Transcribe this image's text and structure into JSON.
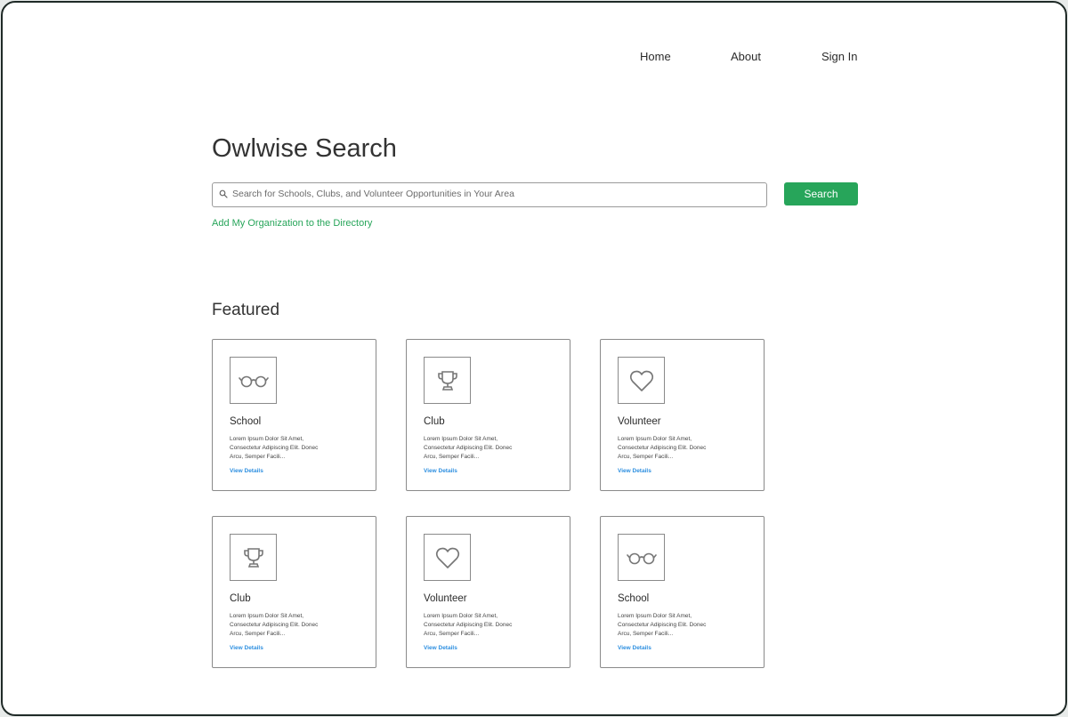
{
  "nav": {
    "home": "Home",
    "about": "About",
    "sign_in": "Sign In"
  },
  "header": {
    "title": "Owlwise Search"
  },
  "search": {
    "placeholder": "Search for Schools, Clubs, and Volunteer Opportunities in Your Area",
    "value": "",
    "button_label": "Search"
  },
  "add_org_link": "Add My Organization to the Directory",
  "featured": {
    "title": "Featured",
    "cards": [
      {
        "type": "School",
        "icon": "glasses-icon",
        "desc": "Lorem Ipsum Dolor Sit Amet, Consectetur Adipiscing Elit. Donec Arcu, Semper Facili...",
        "link": "View Details"
      },
      {
        "type": "Club",
        "icon": "trophy-icon",
        "desc": "Lorem Ipsum Dolor Sit Amet, Consectetur Adipiscing Elit. Donec Arcu, Semper Facili...",
        "link": "View Details"
      },
      {
        "type": "Volunteer",
        "icon": "heart-icon",
        "desc": "Lorem Ipsum Dolor Sit Amet, Consectetur Adipiscing Elit. Donec Arcu, Semper Facili...",
        "link": "View Details"
      },
      {
        "type": "Club",
        "icon": "trophy-icon",
        "desc": "Lorem Ipsum Dolor Sit Amet, Consectetur Adipiscing Elit. Donec Arcu, Semper Facili...",
        "link": "View Details"
      },
      {
        "type": "Volunteer",
        "icon": "heart-icon",
        "desc": "Lorem Ipsum Dolor Sit Amet, Consectetur Adipiscing Elit. Donec Arcu, Semper Facili...",
        "link": "View Details"
      },
      {
        "type": "School",
        "icon": "glasses-icon",
        "desc": "Lorem Ipsum Dolor Sit Amet, Consectetur Adipiscing Elit. Donec Arcu, Semper Facili...",
        "link": "View Details"
      }
    ]
  },
  "colors": {
    "accent": "#27a55a",
    "link": "#2d8fe0",
    "border": "#8a8a8a"
  }
}
